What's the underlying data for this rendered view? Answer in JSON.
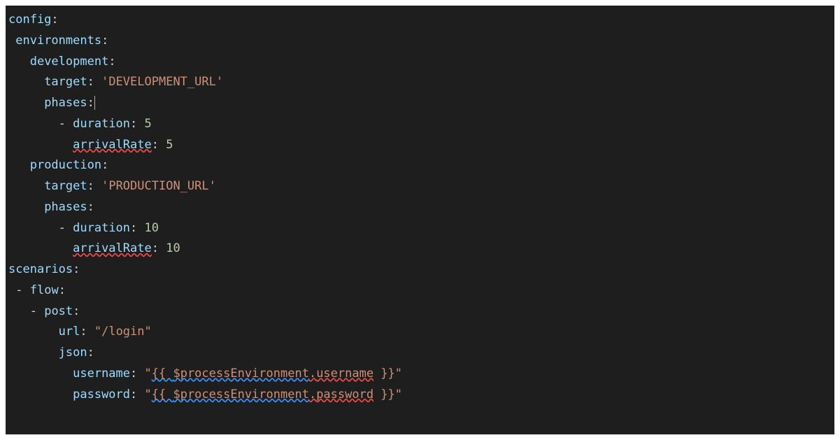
{
  "config": {
    "key": "config",
    "environments": {
      "key": "environments",
      "development": {
        "key": "development",
        "target": {
          "key": "target",
          "value": "'DEVELOPMENT_URL'"
        },
        "phases": {
          "key": "phases",
          "item": {
            "duration": {
              "key": "duration",
              "value": "5"
            },
            "arrivalRate": {
              "key": "arrivalRate",
              "value": "5"
            }
          }
        }
      },
      "production": {
        "key": "production",
        "target": {
          "key": "target",
          "value": "'PRODUCTION_URL'"
        },
        "phases": {
          "key": "phases",
          "item": {
            "duration": {
              "key": "duration",
              "value": "10"
            },
            "arrivalRate": {
              "key": "arrivalRate",
              "value": "10"
            }
          }
        }
      }
    }
  },
  "scenarios": {
    "key": "scenarios",
    "flow": {
      "key": "flow",
      "post": {
        "key": "post",
        "url": {
          "key": "url",
          "value": "\"/login\""
        },
        "json": {
          "key": "json",
          "username": {
            "key": "username",
            "open": "\"",
            "pre": "{{ ",
            "var": "$processEnvironment",
            "dot": ".",
            "prop": "username",
            "post": " }}",
            "close": "\""
          },
          "password": {
            "key": "password",
            "open": "\"",
            "pre": "{{ ",
            "var": "$processEnvironment",
            "dot": ".",
            "prop": "password",
            "post": " }}",
            "close": "\""
          }
        }
      }
    }
  }
}
